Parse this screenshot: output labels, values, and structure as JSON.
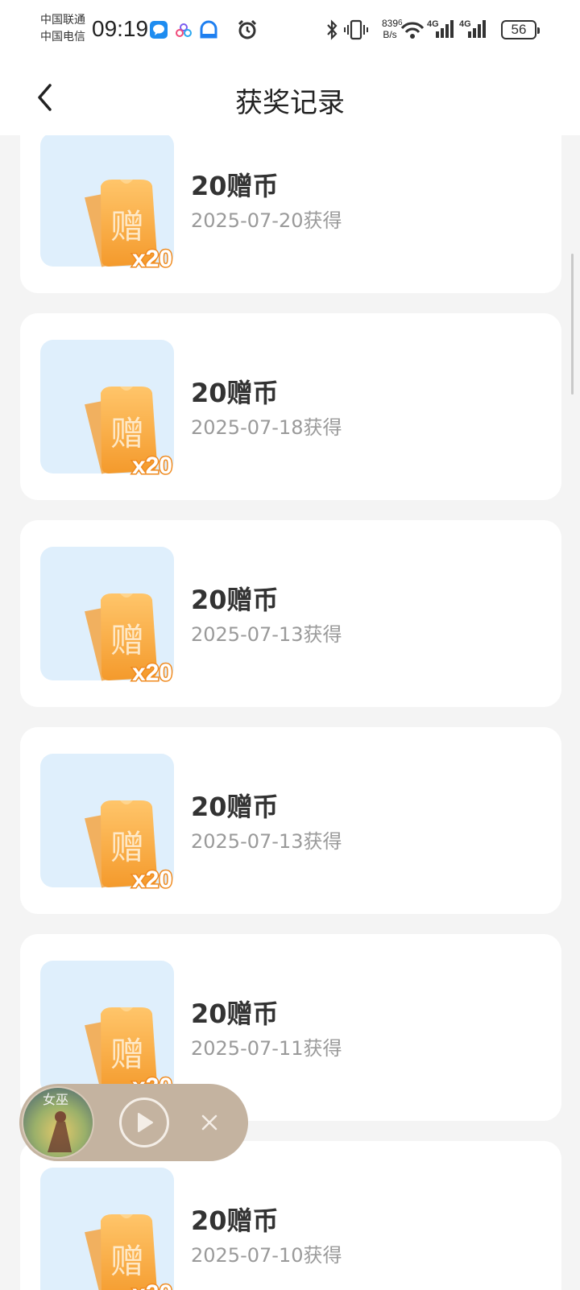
{
  "status_bar": {
    "carrier_1": "中国联通",
    "carrier_2": "中国电信",
    "time": "09:19",
    "net_speed_value": "839",
    "net_speed_unit": "B/s",
    "battery": "56",
    "icons": [
      "message-app-icon",
      "app-icon",
      "cloud-app-icon",
      "alarm-icon",
      "bluetooth-icon",
      "vibrate-icon",
      "wifi-icon",
      "signal-4g-icon",
      "signal-4g-icon"
    ]
  },
  "header": {
    "title": "获奖记录"
  },
  "records": [
    {
      "title": "20赠币",
      "date": "2025-07-20获得"
    },
    {
      "title": "20赠币",
      "date": "2025-07-18获得"
    },
    {
      "title": "20赠币",
      "date": "2025-07-13获得"
    },
    {
      "title": "20赠币",
      "date": "2025-07-13获得"
    },
    {
      "title": "20赠币",
      "date": "2025-07-11获得"
    },
    {
      "title": "20赠币",
      "date": "2025-07-10获得"
    }
  ],
  "coupon": {
    "glyph": "赠",
    "multiplier": "x20"
  },
  "player": {
    "cover_text": "女巫"
  },
  "colors": {
    "thumb_bg": "#dfeffc",
    "coupon_orange": "#f7a43c",
    "player_bg": "#c4b3a0"
  }
}
